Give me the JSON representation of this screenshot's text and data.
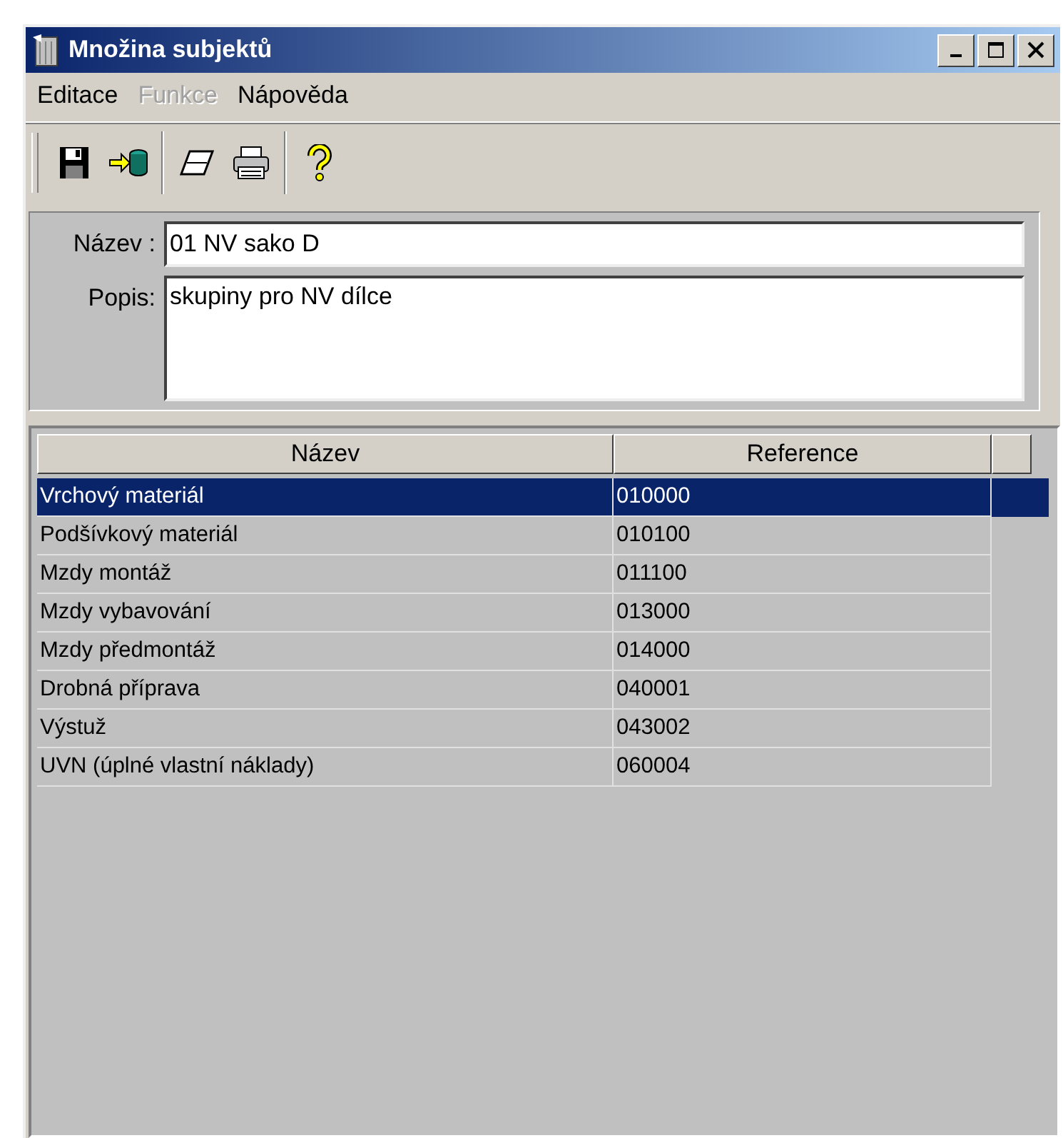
{
  "window": {
    "title": "Množina subjektů"
  },
  "menu": [
    {
      "label": "Editace",
      "disabled": false
    },
    {
      "label": "Funkce",
      "disabled": true
    },
    {
      "label": "Nápověda",
      "disabled": false
    }
  ],
  "toolbar": [
    {
      "kind": "save"
    },
    {
      "kind": "import"
    },
    {
      "kind": "separator"
    },
    {
      "kind": "eraser"
    },
    {
      "kind": "print"
    },
    {
      "kind": "separator"
    },
    {
      "kind": "help"
    }
  ],
  "form": {
    "name_label": "Název :",
    "name_value": "01 NV sako D",
    "description_label": "Popis:",
    "description_value": "skupiny pro NV dílce"
  },
  "table": {
    "columns": [
      "Název",
      "Reference"
    ],
    "rows": [
      {
        "name": "Vrchový materiál",
        "reference": "010000",
        "selected": true
      },
      {
        "name": "Podšívkový materiál",
        "reference": "010100",
        "selected": false
      },
      {
        "name": "Mzdy montáž",
        "reference": "011100",
        "selected": false
      },
      {
        "name": "Mzdy vybavování",
        "reference": "013000",
        "selected": false
      },
      {
        "name": "Mzdy předmontáž",
        "reference": "014000",
        "selected": false
      },
      {
        "name": "Drobná příprava",
        "reference": "040001",
        "selected": false
      },
      {
        "name": "Výstuž",
        "reference": "043002",
        "selected": false
      },
      {
        "name": "UVN (úplné vlastní náklady)",
        "reference": "060004",
        "selected": false
      }
    ]
  }
}
